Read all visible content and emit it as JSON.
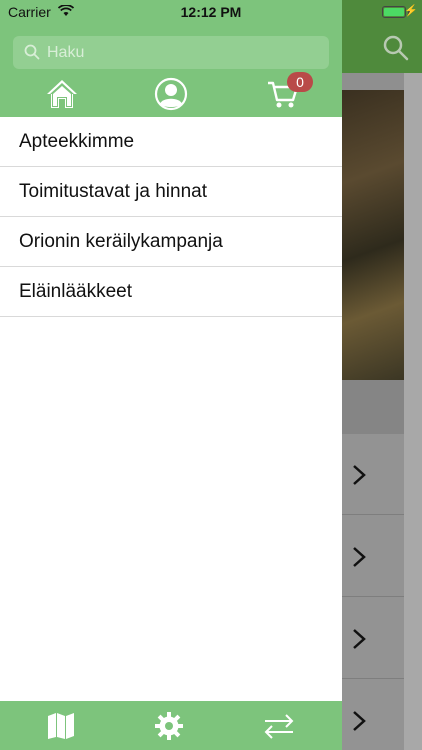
{
  "status_bar": {
    "carrier": "Carrier",
    "time": "12:12 PM"
  },
  "drawer": {
    "search": {
      "placeholder": "Haku"
    },
    "header_icons": [
      "home-icon",
      "user-icon",
      "cart-icon"
    ],
    "cart_count": "0",
    "menu_items": [
      {
        "label": "Apteekkimme"
      },
      {
        "label": "Toimitustavat ja hinnat"
      },
      {
        "label": "Orionin keräilykampanja"
      },
      {
        "label": "Eläinlääkkeet"
      }
    ],
    "footer_icons": [
      "map-icon",
      "gear-icon",
      "swap-arrows-icon"
    ]
  },
  "colors": {
    "drawer_green": "#7dc47c",
    "navbar_green": "#4f8a3c",
    "badge_red": "#b94a48"
  }
}
